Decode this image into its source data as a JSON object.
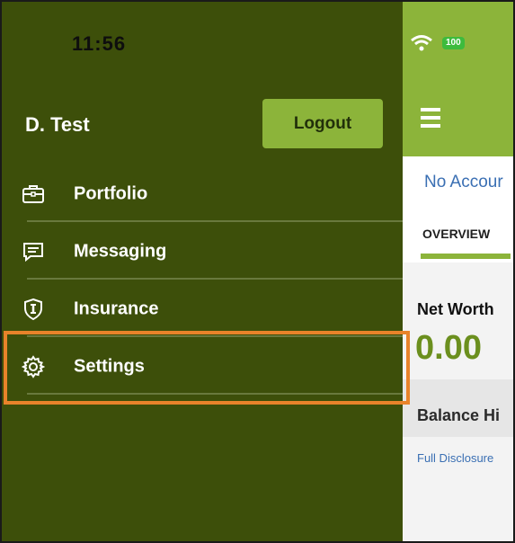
{
  "status_bar": {
    "time": "11:56",
    "battery": "100"
  },
  "drawer": {
    "user_name": "D. Test",
    "logout_label": "Logout",
    "items": [
      {
        "label": "Portfolio",
        "icon": "briefcase-icon"
      },
      {
        "label": "Messaging",
        "icon": "message-icon"
      },
      {
        "label": "Insurance",
        "icon": "shield-icon"
      },
      {
        "label": "Settings",
        "icon": "gear-icon"
      }
    ],
    "highlighted_item": "Settings"
  },
  "app": {
    "no_accounts_text": "No Accour",
    "tab_overview": "OVERVIEW",
    "net_worth_label": "Net Worth",
    "net_worth_value": "0.00",
    "balance_history_label": "Balance Hi",
    "full_disclosure_link": "Full Disclosure"
  },
  "colors": {
    "drawer_bg": "#3d4f0a",
    "accent_green": "#8cb43a",
    "highlight_orange": "#e8832a",
    "link_blue": "#3a6fb3"
  }
}
